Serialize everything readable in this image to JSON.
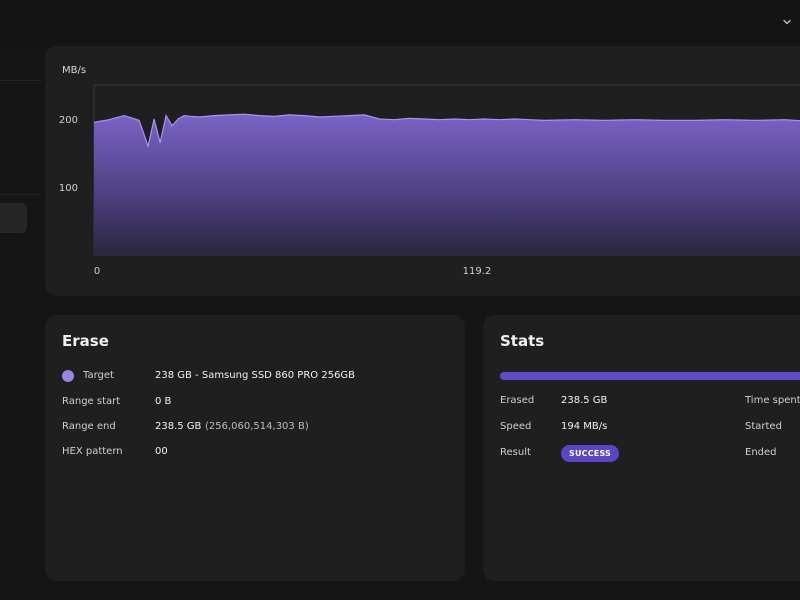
{
  "header": {
    "dropdown_icon": "chevron-down-icon"
  },
  "chart": {
    "unit_label": "MB/s",
    "y_ticks": [
      "200",
      "100"
    ],
    "x_ticks": [
      "0",
      "119.2"
    ],
    "colors": {
      "fill_top": "#7a63c6",
      "fill_bottom": "#2a2540",
      "line": "#a994f0"
    }
  },
  "chart_data": {
    "type": "area",
    "title": "",
    "xlabel": "",
    "ylabel": "MB/s",
    "ylim": [
      0,
      250
    ],
    "xlim": [
      0,
      240
    ],
    "x_tick_labels": [
      "0",
      "119.2"
    ],
    "y_tick_labels": [
      "100",
      "200"
    ],
    "series": [
      {
        "x": [
          0,
          5,
          10,
          15,
          18,
          20,
          22,
          24,
          26,
          28,
          30,
          32,
          35,
          40,
          45,
          50,
          55,
          60,
          65,
          70,
          75,
          80,
          85,
          90,
          95,
          100,
          105,
          110,
          115,
          120,
          125,
          130,
          135,
          140,
          145,
          150,
          160,
          170,
          180,
          190,
          200,
          210,
          220,
          230,
          240
        ],
        "y": [
          195,
          199,
          205,
          198,
          160,
          200,
          165,
          205,
          190,
          200,
          205,
          204,
          203,
          205,
          206,
          207,
          205,
          204,
          206,
          205,
          203,
          204,
          205,
          206,
          200,
          199,
          201,
          200,
          199,
          200,
          199,
          200,
          199,
          200,
          199,
          198,
          199,
          198,
          199,
          198,
          198,
          199,
          198,
          199,
          196
        ]
      }
    ],
    "grid": false,
    "legend": "none"
  },
  "erase": {
    "title": "Erase",
    "rows": [
      {
        "label": "Target",
        "value": "238 GB - Samsung SSD 860 PRO 256GB"
      },
      {
        "label": "Range start",
        "value": "0 B"
      },
      {
        "label": "Range end",
        "value": "238.5 GB",
        "sub": "(256,060,514,303 B)"
      },
      {
        "label": "HEX pattern",
        "value": "00"
      }
    ],
    "target_dot_color": "#9d83e6"
  },
  "stats": {
    "title": "Stats",
    "progress": 1.0,
    "rows": [
      {
        "label": "Erased",
        "value": "238.5 GB"
      },
      {
        "label": "Speed",
        "value": "194 MB/s"
      },
      {
        "label": "Result",
        "badge": "SUCCESS"
      }
    ],
    "right_labels": [
      "Time spent",
      "Started",
      "Ended"
    ],
    "accent": "#5a45c7"
  }
}
